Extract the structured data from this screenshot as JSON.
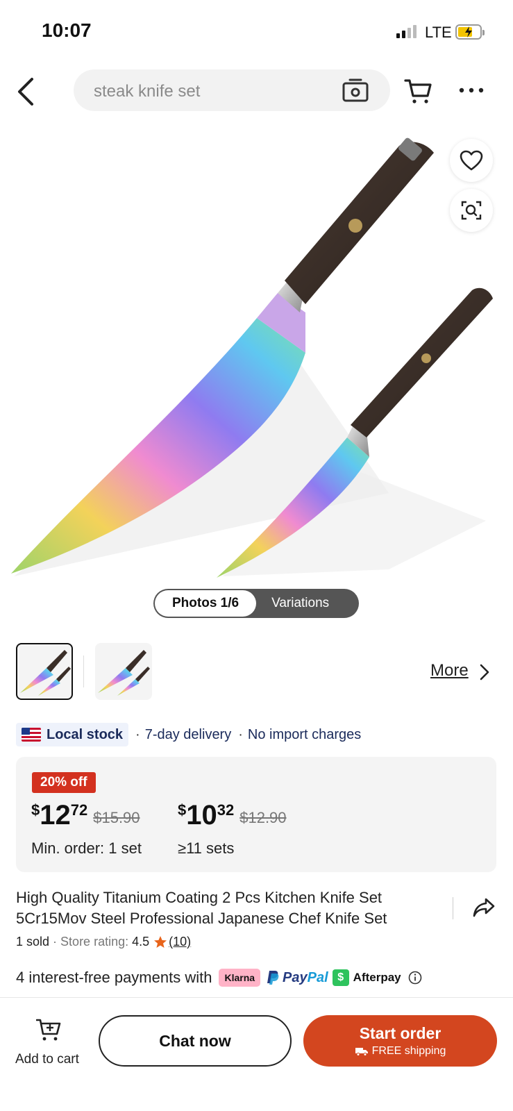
{
  "status_bar": {
    "time": "10:07",
    "network": "LTE"
  },
  "nav": {
    "search_value": "steak knife set",
    "icons": [
      "back-icon",
      "camera-search-icon",
      "cart-icon",
      "more-icon"
    ]
  },
  "gallery": {
    "toggle_photos": "Photos 1/6",
    "toggle_variations": "Variations",
    "more_link": "More"
  },
  "delivery": {
    "badge": "Local stock",
    "info1": "7-day delivery",
    "info2": "No import charges"
  },
  "pricing": {
    "discount": "20% off",
    "tier1": {
      "currency": "$",
      "dollars": "12",
      "cents": "72",
      "original": "$15.90",
      "note": "Min. order: 1 set"
    },
    "tier2": {
      "currency": "$",
      "dollars": "10",
      "cents": "32",
      "original": "$12.90",
      "note": "≥11 sets"
    }
  },
  "product": {
    "title": "High Quality Titanium Coating 2 Pcs Kitchen Knife Set 5Cr15Mov Steel Professional Japanese Chef Knife Set",
    "sold": "1 sold",
    "rating_label": "Store rating:",
    "rating": "4.5",
    "reviews": "(10)"
  },
  "payments": {
    "text": "4 interest-free payments with",
    "klarna": "Klarna",
    "paypal_a": "Pay",
    "paypal_b": "Pal",
    "afterpay": "Afterpay"
  },
  "actions": {
    "add_to_cart": "Add to cart",
    "chat": "Chat now",
    "start_order": "Start order",
    "shipping": "FREE shipping"
  },
  "colors": {
    "accent": "#d3461f",
    "discount": "#d3311f",
    "star": "#e8641b"
  }
}
